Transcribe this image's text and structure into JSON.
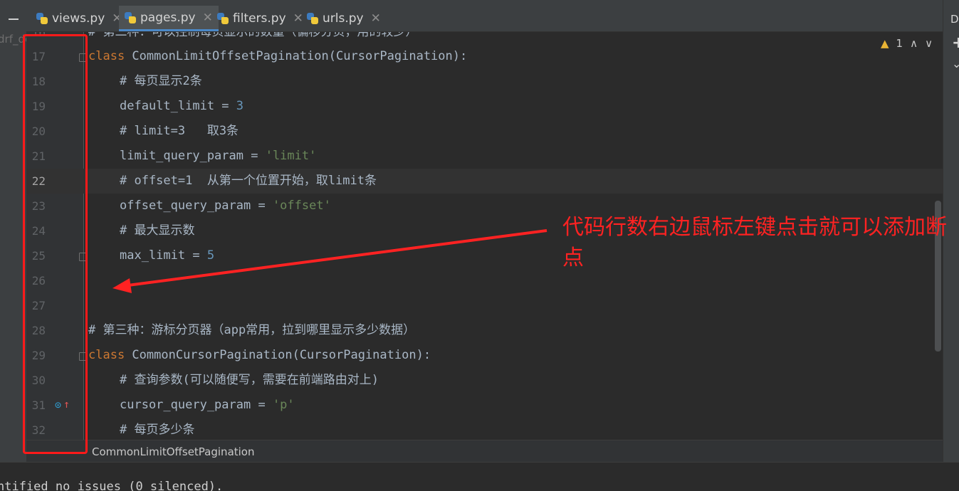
{
  "project_label": "drf_de",
  "tabs": [
    {
      "label": "views.py",
      "active": false
    },
    {
      "label": "pages.py",
      "active": true
    },
    {
      "label": "filters.py",
      "active": false
    },
    {
      "label": "urls.py",
      "active": false
    }
  ],
  "right_panel": {
    "label": "Da"
  },
  "inspection": {
    "warnings": "1"
  },
  "cut_top_line": "# 第二种：可以控制每页显示的数量（偏移分页，用的较少）",
  "lines": [
    {
      "num": "17",
      "code": "class CommonLimitOffsetPagination(CursorPagination):"
    },
    {
      "num": "18",
      "code": "    # 每页显示2条"
    },
    {
      "num": "19",
      "code": "    default_limit = 3"
    },
    {
      "num": "20",
      "code": "    # limit=3   取3条"
    },
    {
      "num": "21",
      "code": "    limit_query_param = 'limit'"
    },
    {
      "num": "22",
      "code": "    # offset=1  从第一个位置开始，取limit条"
    },
    {
      "num": "23",
      "code": "    offset_query_param = 'offset'"
    },
    {
      "num": "24",
      "code": "    # 最大显示数"
    },
    {
      "num": "25",
      "code": "    max_limit = 5"
    },
    {
      "num": "26",
      "code": ""
    },
    {
      "num": "27",
      "code": ""
    },
    {
      "num": "28",
      "code": "# 第三种：游标分页器（app常用，拉到哪里显示多少数据）"
    },
    {
      "num": "29",
      "code": "class CommonCursorPagination(CursorPagination):"
    },
    {
      "num": "30",
      "code": "    # 查询参数(可以随便写，需要在前端路由对上)"
    },
    {
      "num": "31",
      "code": "    cursor_query_param = 'p'"
    },
    {
      "num": "32",
      "code": "    # 每页多少条"
    }
  ],
  "tokens": {
    "class_kw": "class",
    "l17_rest": " CommonLimitOffsetPagination(CursorPagination):",
    "l18": "# 每页显示2条",
    "l19_name": "default_limit = ",
    "l19_val": "3",
    "l20": "# limit=3   取3条",
    "l21_name": "limit_query_param = ",
    "l21_val": "'limit'",
    "l22": "# offset=1  从第一个位置开始，取limit条",
    "l23_name": "offset_query_param = ",
    "l23_val": "'offset'",
    "l24": "# 最大显示数",
    "l25_name": "max_limit = ",
    "l25_val": "5",
    "l28": "# 第三种：游标分页器（app常用，拉到哪里显示多少数据）",
    "l29_rest": " CommonCursorPagination(CursorPagination):",
    "l30": "# 查询参数(可以随便写，需要在前端路由对上)",
    "l31_name": "cursor_query_param = ",
    "l31_val": "'p'",
    "l32": "# 每页多少条"
  },
  "breadcrumb": "CommonLimitOffsetPagination",
  "console_output": "ntified no issues (0 silenced).",
  "annotation": {
    "text": "代码行数右边鼠标左键点击就可以添加断点",
    "color": "#ff2222"
  },
  "colors": {
    "keyword": "#cc7832",
    "comment": "#808080",
    "number": "#6897bb",
    "string": "#6a8759",
    "background": "#2b2b2b"
  }
}
